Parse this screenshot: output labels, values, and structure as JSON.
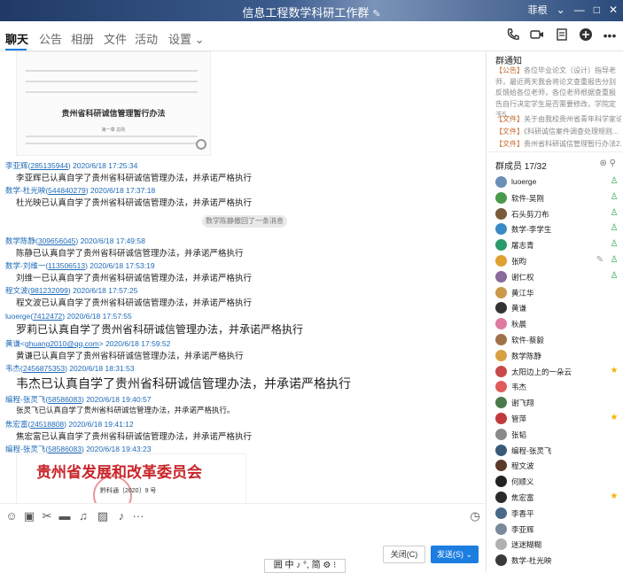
{
  "window": {
    "title": "信息工程数学科研工作群",
    "account": "菲根",
    "controls": [
      "⌄",
      "—",
      "□",
      "✕"
    ]
  },
  "tabs": [
    {
      "label": "聊天"
    },
    {
      "label": "公告"
    },
    {
      "label": "相册"
    },
    {
      "label": "文件"
    },
    {
      "label": "活动"
    },
    {
      "label": "设置 ⌄"
    }
  ],
  "chat": {
    "doc_title": "贵州省科研诚信管理暂行办法",
    "doc_sub": "第一章 总则",
    "system_msg": "数学陈静撤回了一条消息",
    "messages": [
      {
        "sender": "李亚辉(",
        "qq": "285135944",
        "time": ") 2020/6/18 17:25:34",
        "text": "李亚辉已认真自学了贵州省科研诚信管理办法，并承诺严格执行"
      },
      {
        "sender": "数学-杜光映(",
        "qq": "544840279",
        "time": ") 2020/6/18 17:37:18",
        "text": "杜光映已认真自学了贵州省科研诚信管理办法，并承诺严格执行"
      },
      {
        "sender": "数学陈静(",
        "qq": "309656045",
        "time": ") 2020/6/18 17:49:58",
        "text": "陈静已认真自学了贵州省科研诚信管理办法，并承诺严格执行"
      },
      {
        "sender": "数学-刘维一(",
        "qq": "113506513",
        "time": ") 2020/6/18 17:53:19",
        "text": "刘维一已认真自学了贵州省科研诚信管理办法，并承诺严格执行"
      },
      {
        "sender": "程文波(",
        "qq": "981232099",
        "time": ") 2020/6/18 17:57:25",
        "text": "程文波已认真自学了贵州省科研诚信管理办法，并承诺严格执行"
      },
      {
        "sender": "luoerge(",
        "qq": "7412472",
        "time": ") 2020/6/18 17:57:55",
        "text": "罗莉已认真自学了贵州省科研诚信管理办法，并承诺严格执行"
      },
      {
        "sender": "黄谦<",
        "qq": "ghuang2010@qq.com",
        "time": "> 2020/6/18 17:59:52",
        "text": "黄谦已认真自学了贵州省科研诚信管理办法，并承诺严格执行"
      },
      {
        "sender": "韦杰(",
        "qq": "2456875353",
        "time": ") 2020/6/18 18:31:53",
        "text": "韦杰已认真自学了贵州省科研诚信管理办法，并承诺严格执行"
      },
      {
        "sender": "编程-张灵飞(",
        "qq": "58586083",
        "time": ") 2020/6/18 19:40:57",
        "text": "张灵飞已认真自学了贵州省科研诚信管理办法，并承诺严格执行。"
      },
      {
        "sender": "焦宏富(",
        "qq": "24518808",
        "time": ") 2020/6/18 19:41:12",
        "text": "焦宏富已认真自学了贵州省科研诚信管理办法，并承诺严格执行"
      },
      {
        "sender": "编程-张灵飞(",
        "qq": "58586083",
        "time": ") 2020/6/18 19:43:23",
        "text": ""
      }
    ],
    "image_title": "贵州省发展和改革委员会",
    "image_docno": "黔科通〔2020〕9 号"
  },
  "input": {
    "close_label": "关闭(C)",
    "send_label": "发送(S)",
    "send_arrow": "⌄"
  },
  "ime": {
    "text": "囲 中 ♪ °, 简 ⚙ ⁝"
  },
  "notice": {
    "title": "群通知",
    "tag": "【公告】",
    "body": "各位毕业论文（设计）指导老师，最近两天我会将论文查重报告分别反馈给各位老师，各位老师根据查重报告自行决定学生是否需要修改，学院定于5...",
    "files": [
      {
        "tag": "【文件】",
        "name": "关于由我校贵州省青年科学家论..."
      },
      {
        "tag": "【文件】",
        "name": "《科研诚信案件调查处理规则..."
      },
      {
        "tag": "【文件】",
        "name": "贵州省科研诚信管理暂行办法2..."
      }
    ]
  },
  "members": {
    "title": "群成员 17/32",
    "list": [
      {
        "name": "luoerge",
        "color": "#6a8fb8",
        "badge": "admin"
      },
      {
        "name": "软件-吴刚",
        "color": "#4a9a4a",
        "badge": "admin"
      },
      {
        "name": "石头剪刀布",
        "color": "#7a5a3a",
        "badge": "admin"
      },
      {
        "name": "数学-李学生",
        "color": "#3a8ac8",
        "badge": "admin"
      },
      {
        "name": "屠志青",
        "color": "#2a9a6a",
        "badge": "admin"
      },
      {
        "name": "张昀",
        "color": "#e0a030",
        "badge": "pen-admin"
      },
      {
        "name": "谢仁权",
        "color": "#8a6a9a",
        "badge": "admin"
      },
      {
        "name": "黄江华",
        "color": "#c89a4a",
        "badge": ""
      },
      {
        "name": "黄谦",
        "color": "#333333",
        "badge": ""
      },
      {
        "name": "秋晨",
        "color": "#e07aa0",
        "badge": ""
      },
      {
        "name": "软件-蔡毅",
        "color": "#a0724a",
        "badge": ""
      },
      {
        "name": "数学陈静",
        "color": "#d8a040",
        "badge": ""
      },
      {
        "name": "太阳边上的一朵云",
        "color": "#c84a4a",
        "badge": "star"
      },
      {
        "name": "韦杰",
        "color": "#e05a5a",
        "badge": ""
      },
      {
        "name": "谢飞翔",
        "color": "#4a7a4a",
        "badge": ""
      },
      {
        "name": "管萍",
        "color": "#c03a3a",
        "badge": "star"
      },
      {
        "name": "张韬",
        "color": "#8a8a8a",
        "badge": ""
      },
      {
        "name": "编程-张灵飞",
        "color": "#3a5a7a",
        "badge": ""
      },
      {
        "name": "程文波",
        "color": "#5a3a2a",
        "badge": ""
      },
      {
        "name": "何顺义",
        "color": "#222222",
        "badge": ""
      },
      {
        "name": "焦宏富",
        "color": "#2a2a2a",
        "badge": "star"
      },
      {
        "name": "李香平",
        "color": "#4a6a8a",
        "badge": ""
      },
      {
        "name": "李亚辉",
        "color": "#7a8a9a",
        "badge": ""
      },
      {
        "name": "迷迷糊糊",
        "color": "#b0b0b0",
        "badge": ""
      },
      {
        "name": "数学-杜光映",
        "color": "#3a3a3a",
        "badge": ""
      }
    ]
  }
}
